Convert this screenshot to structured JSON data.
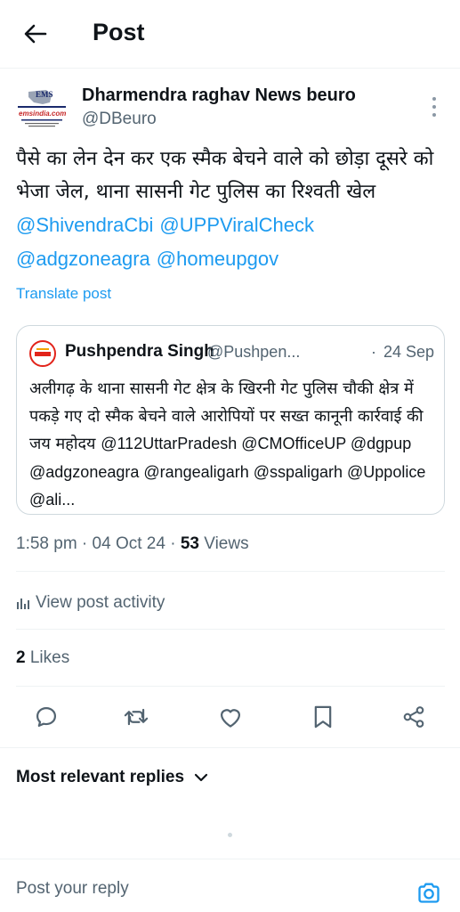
{
  "header": {
    "title": "Post",
    "back_icon": "arrow-left-icon"
  },
  "post": {
    "author_name": "Dharmendra raghav News beuro",
    "author_handle": "@DBeuro",
    "avatar_logo_text": "EMS",
    "avatar_logo_sub": "emsindia.com",
    "text_line": "पैसे का लेन देन कर एक स्मैक बेचने वाले को छोड़ा दूसरे को भेजा जेल, थाना सासनी गेट पुलिस का रिश्वती खेल ",
    "mentions": [
      "@ShivendraCbi",
      "@UPPViralCheck",
      "@adgzoneagra",
      "@homeupgov"
    ],
    "translate_label": "Translate post",
    "time": "1:58 pm",
    "date": "04 Oct 24",
    "views_count": "53",
    "views_label": "Views",
    "activity_label": "View post activity",
    "likes_count": "2",
    "likes_label": "Likes"
  },
  "quote": {
    "name": "Pushpendra Singh",
    "handle": "@Pushpen...",
    "date": "24 Sep",
    "text_hindi": "अलीगढ़ के थाना सासनी गेट क्षेत्र के खिरनी गेट पुलिस चौकी क्षेत्र में पकड़े गए दो स्मैक बेचने वाले आरोपियों पर सख्त कानूनी कार्रवाई की जय महोदय ",
    "text_tags": "@112UttarPradesh @CMOfficeUP @dgpup @adgzoneagra @rangealigarh @sspaligarh @Uppolice @ali..."
  },
  "replies": {
    "sort_label": "Most relevant replies",
    "input_placeholder": "Post your reply"
  },
  "colors": {
    "accent": "#1d9bf0",
    "text_primary": "#0f1419",
    "text_secondary": "#536471",
    "border": "#cfd9de"
  }
}
